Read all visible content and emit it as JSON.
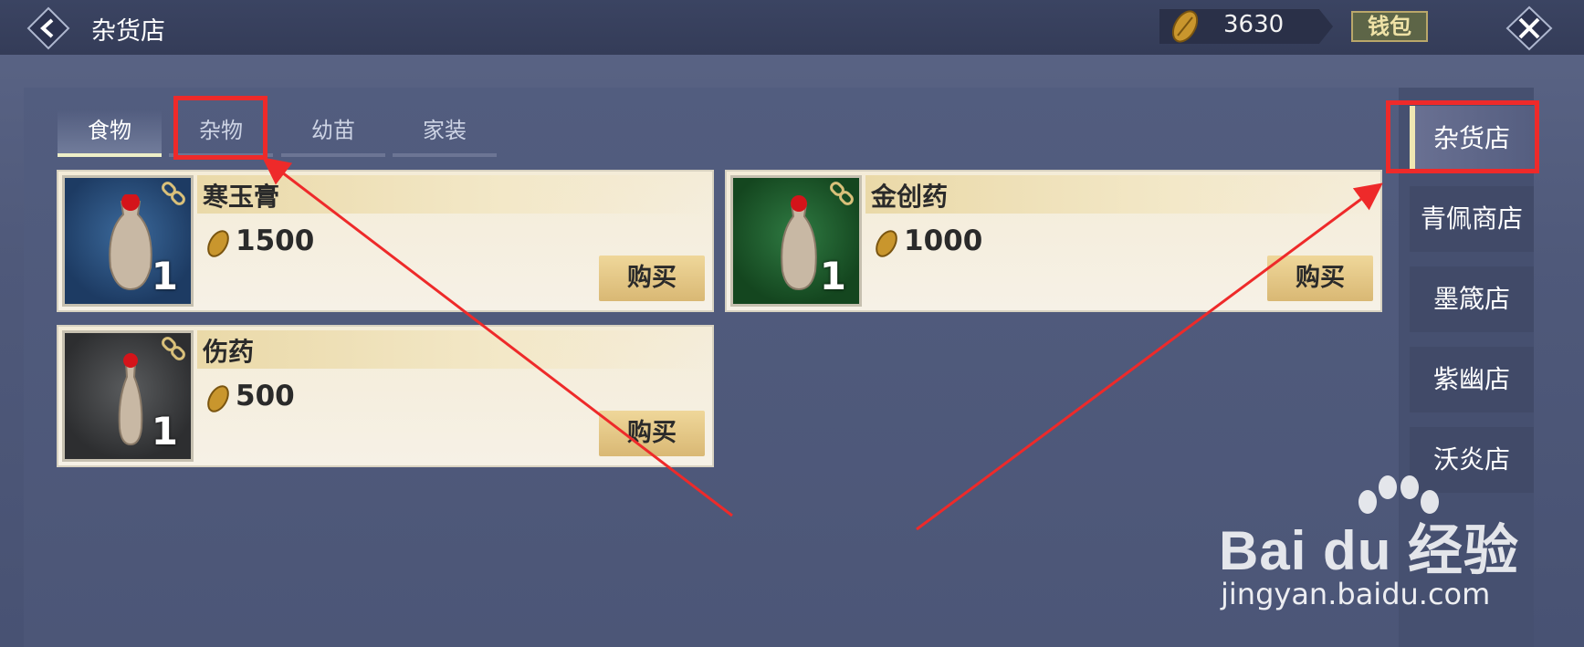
{
  "header": {
    "title": "杂货店",
    "coin_amount": "3630",
    "wallet_label": "钱包"
  },
  "tabs": [
    {
      "label": "食物",
      "active": true
    },
    {
      "label": "杂物",
      "active": false
    },
    {
      "label": "幼苗",
      "active": false
    },
    {
      "label": "家装",
      "active": false
    }
  ],
  "items": [
    {
      "name": "寒玉膏",
      "price": "1500",
      "quantity": "1",
      "buy_label": "购买",
      "image_bg": "blue"
    },
    {
      "name": "金创药",
      "price": "1000",
      "quantity": "1",
      "buy_label": "购买",
      "image_bg": "green"
    },
    {
      "name": "伤药",
      "price": "500",
      "quantity": "1",
      "buy_label": "购买",
      "image_bg": "gray"
    }
  ],
  "shops": [
    {
      "label": "杂货店",
      "active": true
    },
    {
      "label": "青佩商店",
      "active": false
    },
    {
      "label": "墨箴店",
      "active": false
    },
    {
      "label": "紫幽店",
      "active": false
    },
    {
      "label": "沃炎店",
      "active": false
    }
  ],
  "watermark": {
    "brand": "Bai du 经验",
    "url": "jingyan.baidu.com"
  },
  "colors": {
    "background": "#4f597a",
    "annotation_red": "#ee2a2a",
    "card_bg": "#f5efe2",
    "buy_button": "#e3c483",
    "active_tab_line": "#eef0c8"
  },
  "icons": [
    "back-arrow-icon",
    "coin-icon",
    "close-x-icon",
    "chain-link-icon",
    "vase-icon"
  ]
}
